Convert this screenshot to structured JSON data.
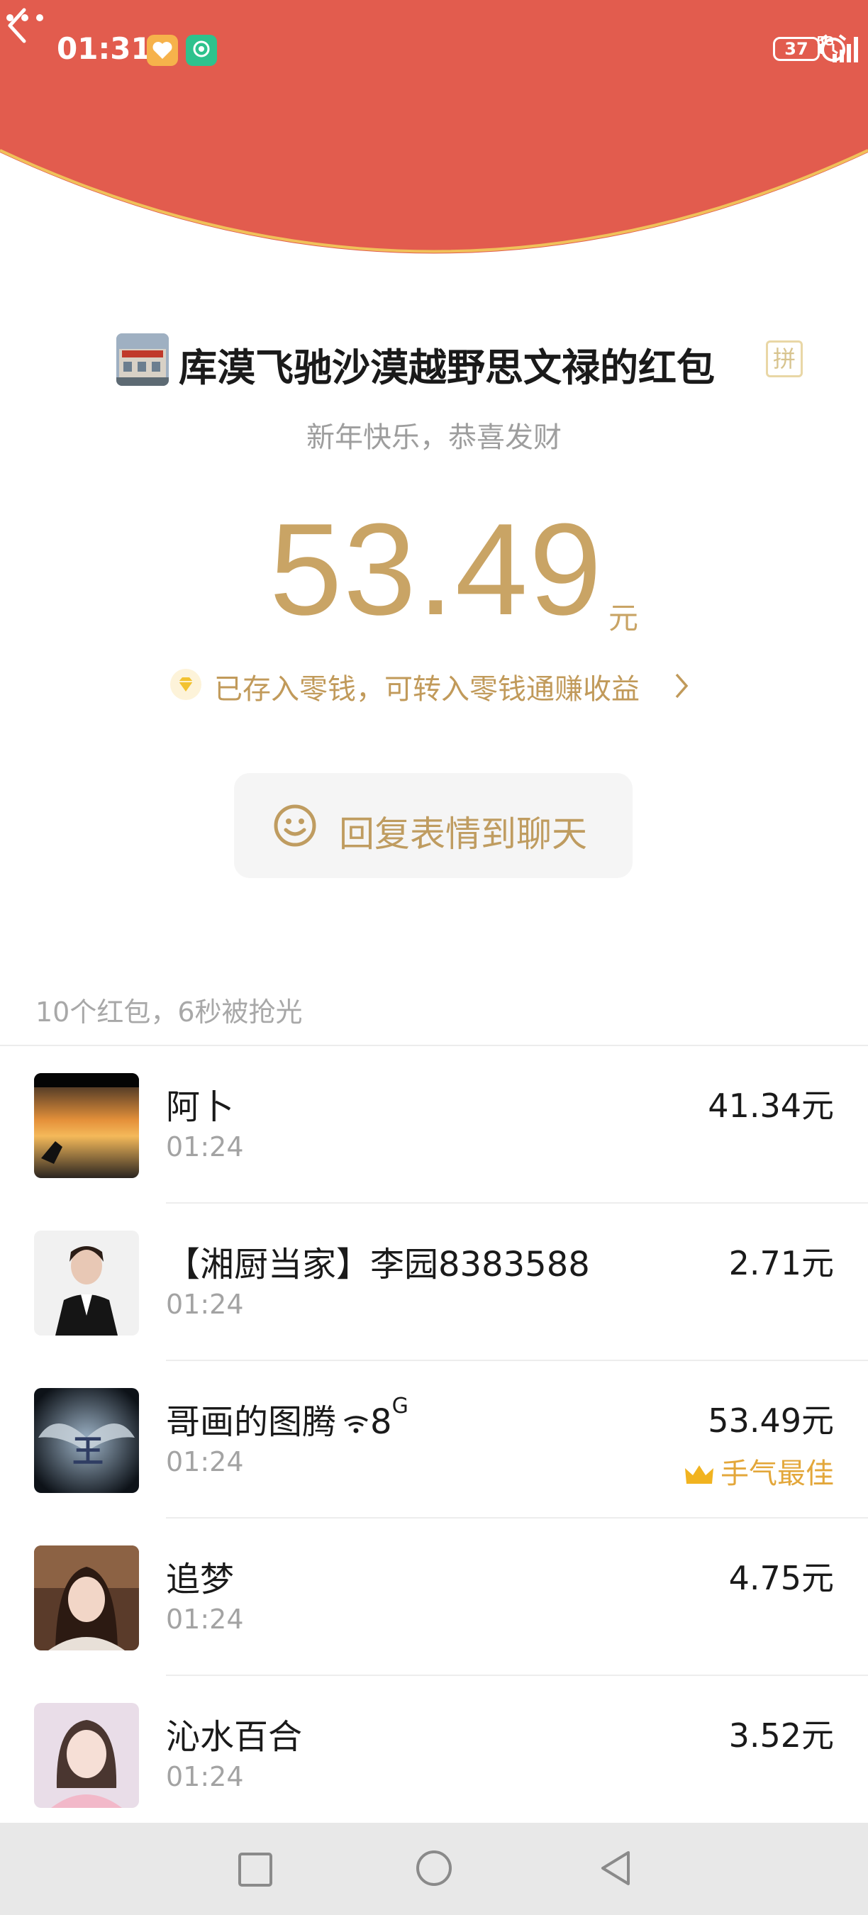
{
  "status_bar": {
    "time": "01:31",
    "network_1": "5G",
    "network_2": "5G",
    "battery": "37"
  },
  "header": {
    "sender_title": "库漠飞驰沙漠越野思文禄的红包",
    "badge": "拼",
    "blessing": "新年快乐，恭喜发财",
    "amount": "53.49",
    "amount_unit": "元",
    "saved_note": "已存入零钱，可转入零钱通赚收益",
    "reply_button": "回复表情到聊天"
  },
  "summary": "10个红包，6秒被抢光",
  "records": [
    {
      "name": "阿卜",
      "time": "01:24",
      "amount": "41.34元"
    },
    {
      "name": "【湘厨当家】李园8383588",
      "time": "01:24",
      "amount": "2.71元"
    },
    {
      "name": "哥画的图腾",
      "name_suffix": "8",
      "name_suffix_sup": "G",
      "time": "01:24",
      "amount": "53.49元",
      "best_label": "手气最佳"
    },
    {
      "name": "追梦",
      "time": "01:24",
      "amount": "4.75元"
    },
    {
      "name": "沁水百合",
      "time": "01:24",
      "amount": "3.52元"
    }
  ],
  "colors": {
    "header_red": "#e25c4e",
    "gold_text": "#c9a465",
    "best_orange": "#e3a73a"
  },
  "icons": [
    "back-arrow-icon",
    "more-icon",
    "alarm-icon",
    "signal-icon",
    "battery-icon",
    "gem-icon",
    "chevron-right-icon",
    "smile-icon",
    "crown-icon",
    "wifi-icon",
    "nav-recent-icon",
    "nav-home-icon",
    "nav-back-icon"
  ]
}
